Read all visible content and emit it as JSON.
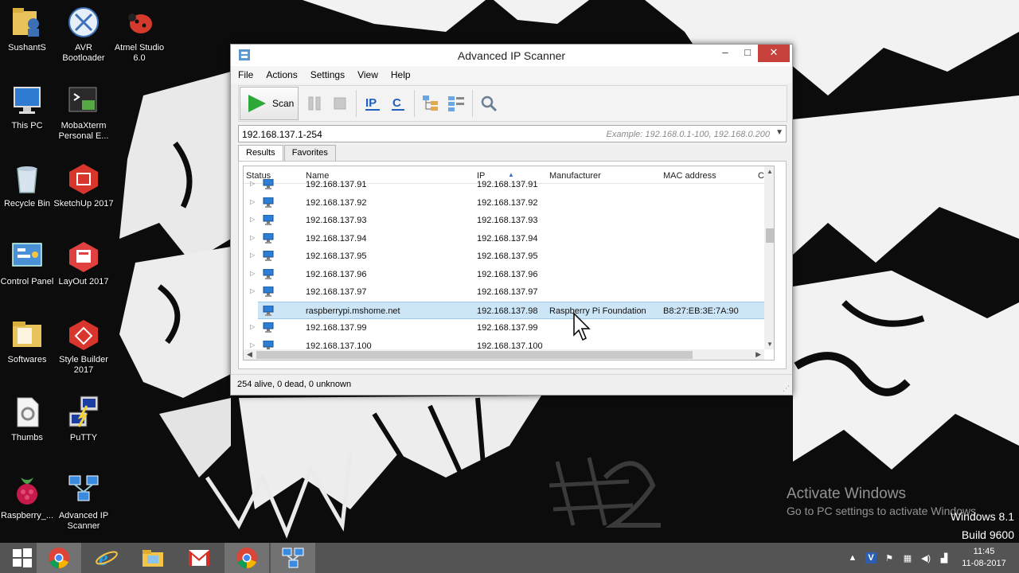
{
  "desktop": {
    "icons": [
      {
        "label": "SushantS"
      },
      {
        "label": "AVR Bootloader"
      },
      {
        "label": "Atmel Studio 6.0"
      },
      {
        "label": "This PC"
      },
      {
        "label": "MobaXterm Personal E..."
      },
      {
        "label": "Recycle Bin"
      },
      {
        "label": "SketchUp 2017"
      },
      {
        "label": "Control Panel"
      },
      {
        "label": "LayOut 2017"
      },
      {
        "label": "Softwares"
      },
      {
        "label": "Style Builder 2017"
      },
      {
        "label": "Thumbs"
      },
      {
        "label": "PuTTY"
      },
      {
        "label": "Raspberry_..."
      },
      {
        "label": "Advanced IP Scanner"
      }
    ],
    "watermark": {
      "title": "Activate Windows",
      "subtitle": "Go to PC settings to activate Windows.",
      "version": "Windows 8.1",
      "build": "Build 9600"
    }
  },
  "window": {
    "title": "Advanced IP Scanner",
    "controls": {
      "minimize": "–",
      "maximize": "□",
      "close": "✕"
    },
    "menu": [
      "File",
      "Actions",
      "Settings",
      "View",
      "Help"
    ],
    "toolbar": {
      "scan_label": "Scan"
    },
    "address": {
      "value": "192.168.137.1-254",
      "placeholder": "Example: 192.168.0.1-100, 192.168.0.200"
    },
    "tabs": [
      "Results",
      "Favorites"
    ],
    "columns": [
      "Status",
      "Name",
      "IP",
      "Manufacturer",
      "MAC address",
      "C"
    ],
    "rows": [
      {
        "name": "192.168.137.91",
        "ip": "192.168.137.91",
        "manufacturer": "",
        "mac": ""
      },
      {
        "name": "192.168.137.92",
        "ip": "192.168.137.92",
        "manufacturer": "",
        "mac": ""
      },
      {
        "name": "192.168.137.93",
        "ip": "192.168.137.93",
        "manufacturer": "",
        "mac": ""
      },
      {
        "name": "192.168.137.94",
        "ip": "192.168.137.94",
        "manufacturer": "",
        "mac": ""
      },
      {
        "name": "192.168.137.95",
        "ip": "192.168.137.95",
        "manufacturer": "",
        "mac": ""
      },
      {
        "name": "192.168.137.96",
        "ip": "192.168.137.96",
        "manufacturer": "",
        "mac": ""
      },
      {
        "name": "192.168.137.97",
        "ip": "192.168.137.97",
        "manufacturer": "",
        "mac": ""
      },
      {
        "name": "raspberrypi.mshome.net",
        "ip": "192.168.137.98",
        "manufacturer": "Raspberry Pi Foundation",
        "mac": "B8:27:EB:3E:7A:90",
        "selected": true
      },
      {
        "name": "192.168.137.99",
        "ip": "192.168.137.99",
        "manufacturer": "",
        "mac": ""
      },
      {
        "name": "192.168.137.100",
        "ip": "192.168.137.100",
        "manufacturer": "",
        "mac": ""
      }
    ],
    "status_text": "254 alive, 0 dead, 0 unknown"
  },
  "taskbar": {
    "items": [
      "start-button",
      "chrome",
      "internet-explorer",
      "file-explorer",
      "gmail",
      "chrome-2",
      "advanced-ip-scanner"
    ],
    "clock": {
      "time": "11:45",
      "date": "11-08-2017"
    }
  },
  "colors": {
    "selection": "#cde6f7",
    "close_button": "#c7413c",
    "scan_green": "#2fa83a",
    "taskbar": "#585858"
  }
}
